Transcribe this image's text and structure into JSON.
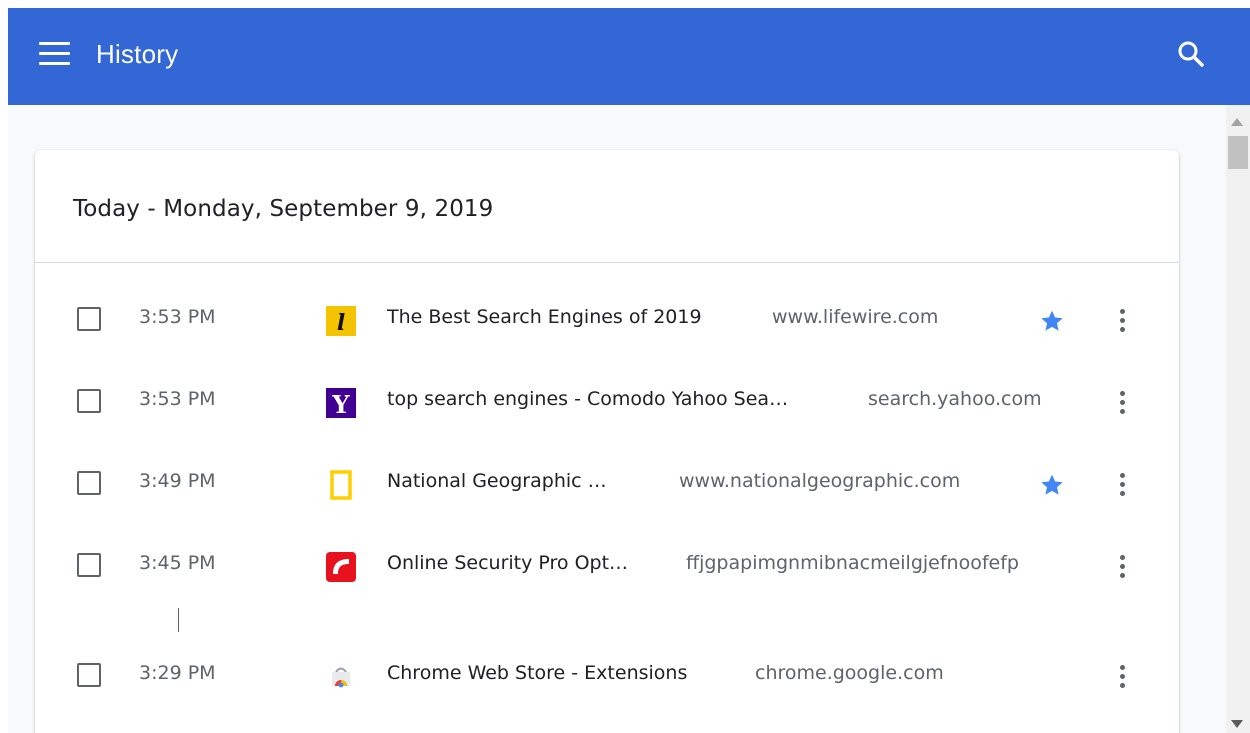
{
  "header": {
    "title": "History",
    "background": "#3367d6"
  },
  "card": {
    "date_heading": "Today - Monday, September 9, 2019"
  },
  "entries": [
    {
      "time": "3:53 PM",
      "title": "The Best Search Engines of 2019",
      "domain": "www.lifewire.com",
      "starred": true,
      "favicon": "lifewire-icon"
    },
    {
      "time": "3:53 PM",
      "title": "top search engines - Comodo Yahoo Sea…",
      "domain": "search.yahoo.com",
      "starred": false,
      "favicon": "yahoo-icon"
    },
    {
      "time": "3:49 PM",
      "title": "National Geographic …",
      "domain": "www.nationalgeographic.com",
      "starred": true,
      "favicon": "natgeo-icon"
    },
    {
      "time": "3:45 PM",
      "title": "Online Security Pro Opt…",
      "domain": "ffjgpapimgnmibnacmeilgjefnoofefp",
      "starred": false,
      "favicon": "comodo-security-icon"
    },
    {
      "time": "3:29 PM",
      "title": "Chrome Web Store - Extensions",
      "domain": "chrome.google.com",
      "starred": false,
      "favicon": "chrome-web-store-icon"
    }
  ],
  "colors": {
    "accent": "#3367d6",
    "star": "#4285f4",
    "lifewire": "#f5c400",
    "yahoo": "#410093",
    "natgeo": "#ffce00",
    "comodo": "#e8111e"
  }
}
